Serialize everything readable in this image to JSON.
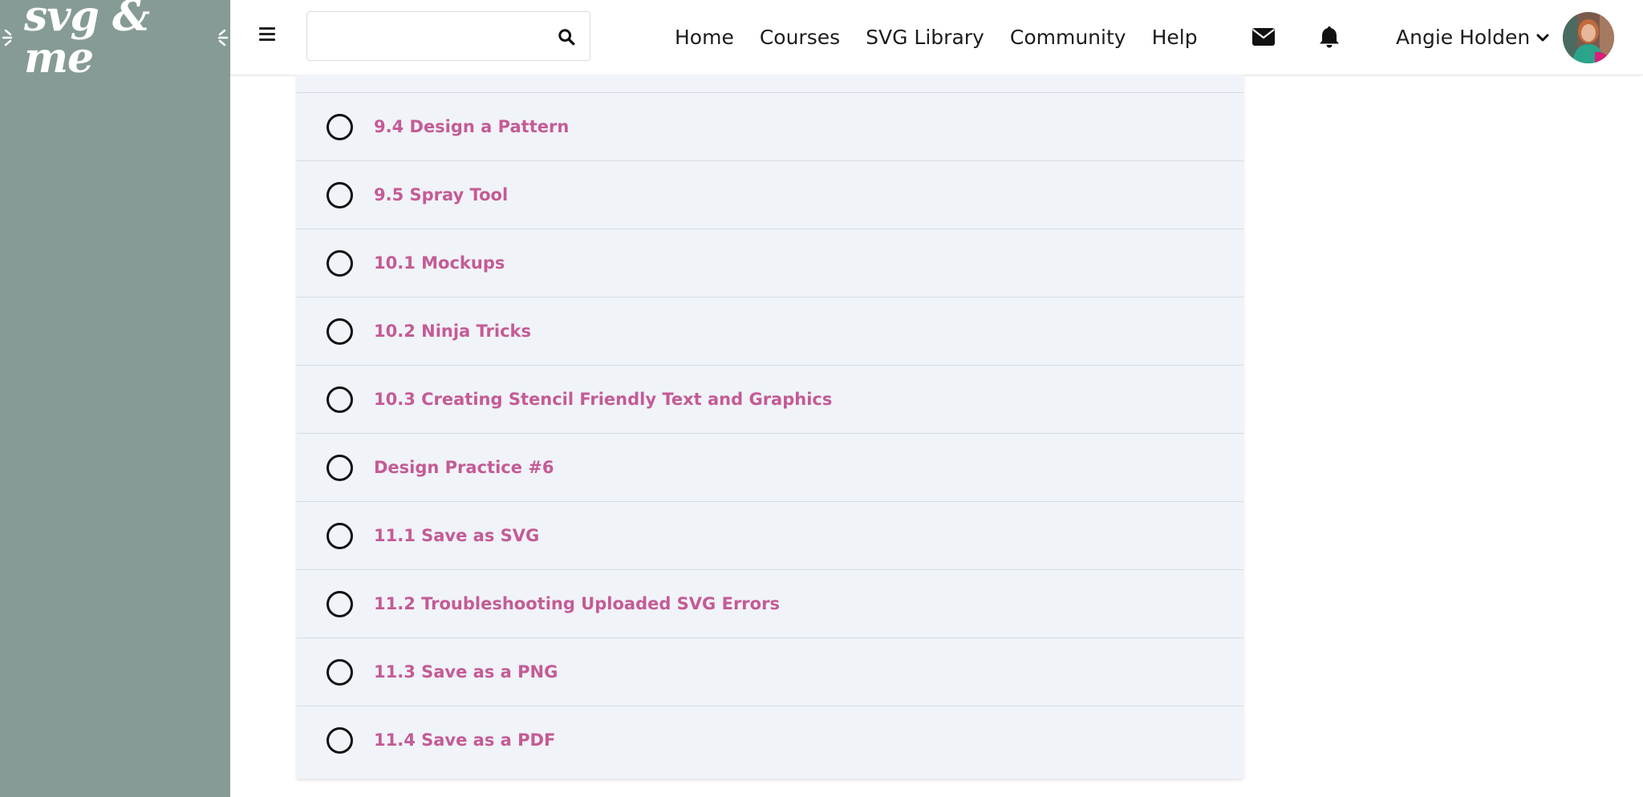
{
  "brand": {
    "logo_text": "svg & me"
  },
  "search": {
    "value": "",
    "placeholder": ""
  },
  "nav": {
    "items": [
      {
        "label": "Home"
      },
      {
        "label": "Courses"
      },
      {
        "label": "SVG Library"
      },
      {
        "label": "Community"
      },
      {
        "label": "Help"
      }
    ]
  },
  "user": {
    "name": "Angie Holden"
  },
  "icons": {
    "menu": "hamburger-icon",
    "search": "search-icon",
    "messages": "envelope-icon",
    "notifications": "bell-icon",
    "user_menu": "chevron-down-icon"
  },
  "colors": {
    "sidebar": "#869b96",
    "lesson_title": "#c45b96",
    "lesson_bg": "#f0f3f8"
  },
  "lessons": [
    {
      "title": "9.4 Design a Pattern",
      "completed": false
    },
    {
      "title": "9.5 Spray Tool",
      "completed": false
    },
    {
      "title": "10.1 Mockups",
      "completed": false
    },
    {
      "title": "10.2 Ninja Tricks",
      "completed": false
    },
    {
      "title": "10.3 Creating Stencil Friendly Text and Graphics",
      "completed": false
    },
    {
      "title": "Design Practice #6",
      "completed": false
    },
    {
      "title": "11.1 Save as SVG",
      "completed": false
    },
    {
      "title": "11.2 Troubleshooting Uploaded SVG Errors",
      "completed": false
    },
    {
      "title": "11.3 Save as a PNG",
      "completed": false
    },
    {
      "title": "11.4 Save as a PDF",
      "completed": false
    }
  ]
}
